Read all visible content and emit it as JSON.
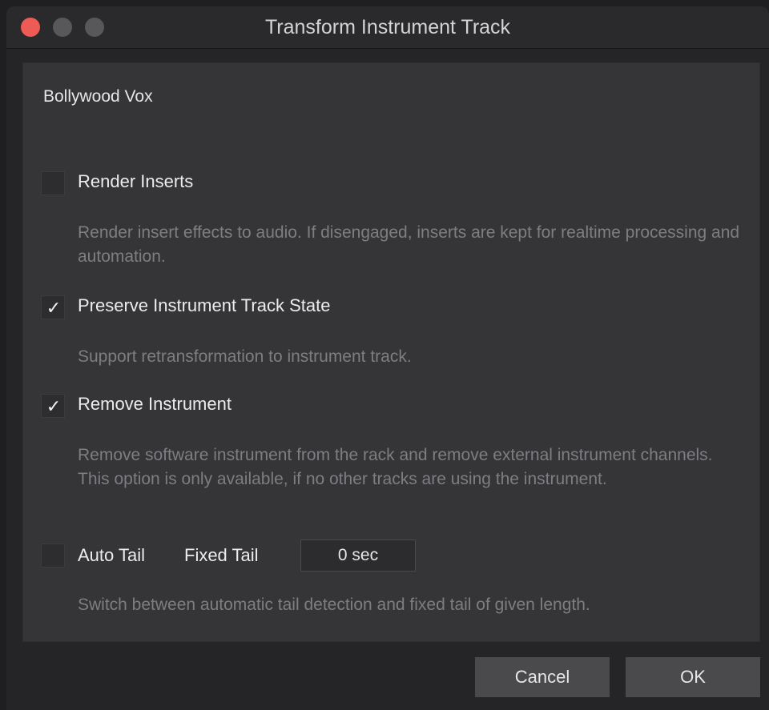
{
  "window": {
    "title": "Transform Instrument Track"
  },
  "track_name": "Bollywood Vox",
  "options": [
    {
      "label": "Render Inserts",
      "checked": false,
      "description": "Render insert effects to audio. If disengaged, inserts are kept for realtime processing and automation."
    },
    {
      "label": "Preserve Instrument Track State",
      "checked": true,
      "description": "Support retransformation to instrument track."
    },
    {
      "label": "Remove Instrument",
      "checked": true,
      "description": "Remove software instrument from the rack and remove external instrument channels. This option is only available, if no other tracks are using the instrument."
    },
    {
      "label": "Auto Tail",
      "checked": false,
      "description": "Switch between automatic tail detection and fixed tail of given length."
    }
  ],
  "fixed_tail": {
    "label": "Fixed Tail",
    "value": "0 sec"
  },
  "checkmark_glyph": "✓",
  "buttons": {
    "cancel": "Cancel",
    "ok": "OK"
  },
  "colors": {
    "close": "#ee5b55",
    "background": "#252527",
    "panel": "#353537"
  }
}
